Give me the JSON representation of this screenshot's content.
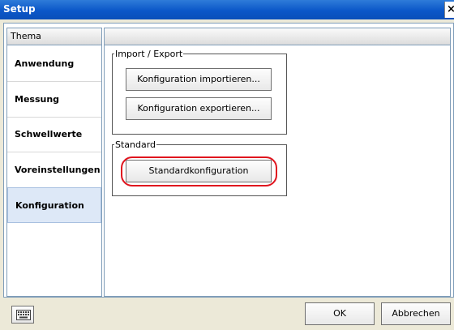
{
  "window": {
    "title": "Setup",
    "close_glyph": "×"
  },
  "sidebar": {
    "header": "Thema",
    "items": [
      {
        "label": "Anwendung",
        "active": false
      },
      {
        "label": "Messung",
        "active": false
      },
      {
        "label": "Schwellwerte",
        "active": false
      },
      {
        "label": "Voreinstellungen",
        "active": false
      },
      {
        "label": "Konfiguration",
        "active": true
      }
    ]
  },
  "content": {
    "import_export": {
      "legend": "Import / Export",
      "import_button": "Konfiguration importieren...",
      "export_button": "Konfiguration exportieren..."
    },
    "standard": {
      "legend": "Standard",
      "default_button": "Standardkonfiguration"
    }
  },
  "footer": {
    "keyboard_icon": "keyboard-icon",
    "ok_button": "OK",
    "cancel_button": "Abbrechen"
  },
  "colors": {
    "titlebar": "#0b57c8",
    "active_item": "#dde8f7",
    "highlight": "#e0141e"
  }
}
